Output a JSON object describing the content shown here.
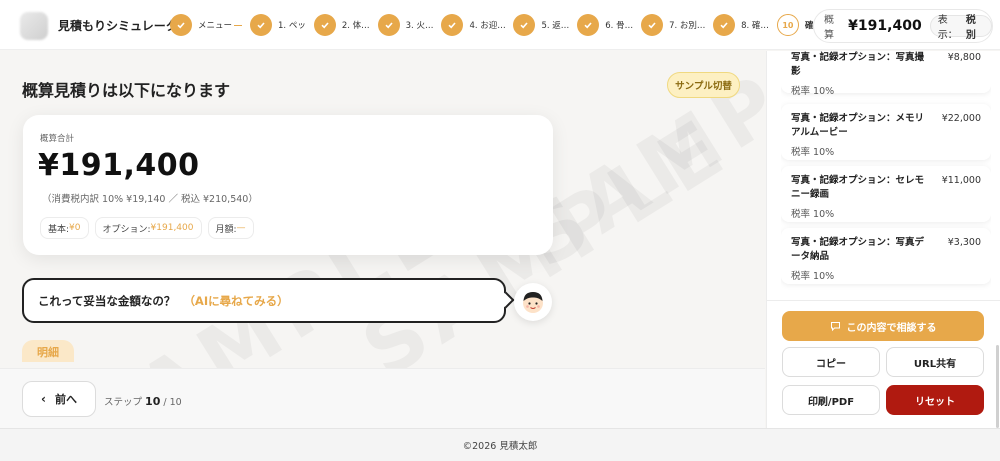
{
  "header": {
    "title": "見積もりシミュレーター",
    "steps": [
      {
        "label": "メニュー",
        "number": ""
      },
      {
        "label": "1. ペッ",
        "number": ""
      },
      {
        "label": "2. 体…",
        "number": ""
      },
      {
        "label": "3. 火…",
        "number": ""
      },
      {
        "label": "4. お迎…",
        "number": ""
      },
      {
        "label": "5. 返…",
        "number": ""
      },
      {
        "label": "6. 骨…",
        "number": ""
      },
      {
        "label": "7. お別…",
        "number": ""
      },
      {
        "label": "8. 確…",
        "number": ""
      },
      {
        "label": "確認",
        "number": "10"
      }
    ],
    "estimate_label": "概算",
    "estimate_amount": "¥191,400",
    "tax_toggle_label": "表示：",
    "tax_toggle_value": "税別"
  },
  "main": {
    "heading": "概算見積りは以下になります",
    "sample_button": "サンプル切替",
    "watermark_text": "SAMPLE",
    "summary": {
      "label": "概算合計",
      "total": "¥191,400",
      "tax_note": "（消費税内訳 10% ¥19,140 ／ 税込 ¥210,540）",
      "chips": [
        {
          "label": "基本:",
          "value": "¥0"
        },
        {
          "label": "オプション:",
          "value": "¥191,400"
        },
        {
          "label": "月額:",
          "value": "—"
        }
      ]
    },
    "ai_prompt": "これって妥当な金額なの？",
    "ai_link": "（AIに尋ねてみる）",
    "details_tab": "明細"
  },
  "nav": {
    "prev_label": "前へ",
    "step_prefix": "ステップ",
    "step_current": "10",
    "step_total": "/ 10"
  },
  "sidebar": {
    "items": [
      {
        "name": "写真・記録オプション：写真撮影",
        "price": "¥8,800",
        "tax": "税率 10%"
      },
      {
        "name": "写真・記録オプション：メモリアルムービー",
        "price": "¥22,000",
        "tax": "税率 10%"
      },
      {
        "name": "写真・記録オプション：セレモニー録画",
        "price": "¥11,000",
        "tax": "税率 10%"
      },
      {
        "name": "写真・記録オプション：写真データ納品",
        "price": "¥3,300",
        "tax": "税率 10%"
      }
    ],
    "consult_button": "この内容で相談する",
    "copy_button": "コピー",
    "url_share_button": "URL共有",
    "print_button": "印刷/PDF",
    "reset_button": "リセット"
  },
  "footer": {
    "copyright": "©2026 見積太郎"
  },
  "colors": {
    "accent": "#e7a84a",
    "reset": "#b01a10",
    "sample_bg": "#fdf0c2"
  }
}
